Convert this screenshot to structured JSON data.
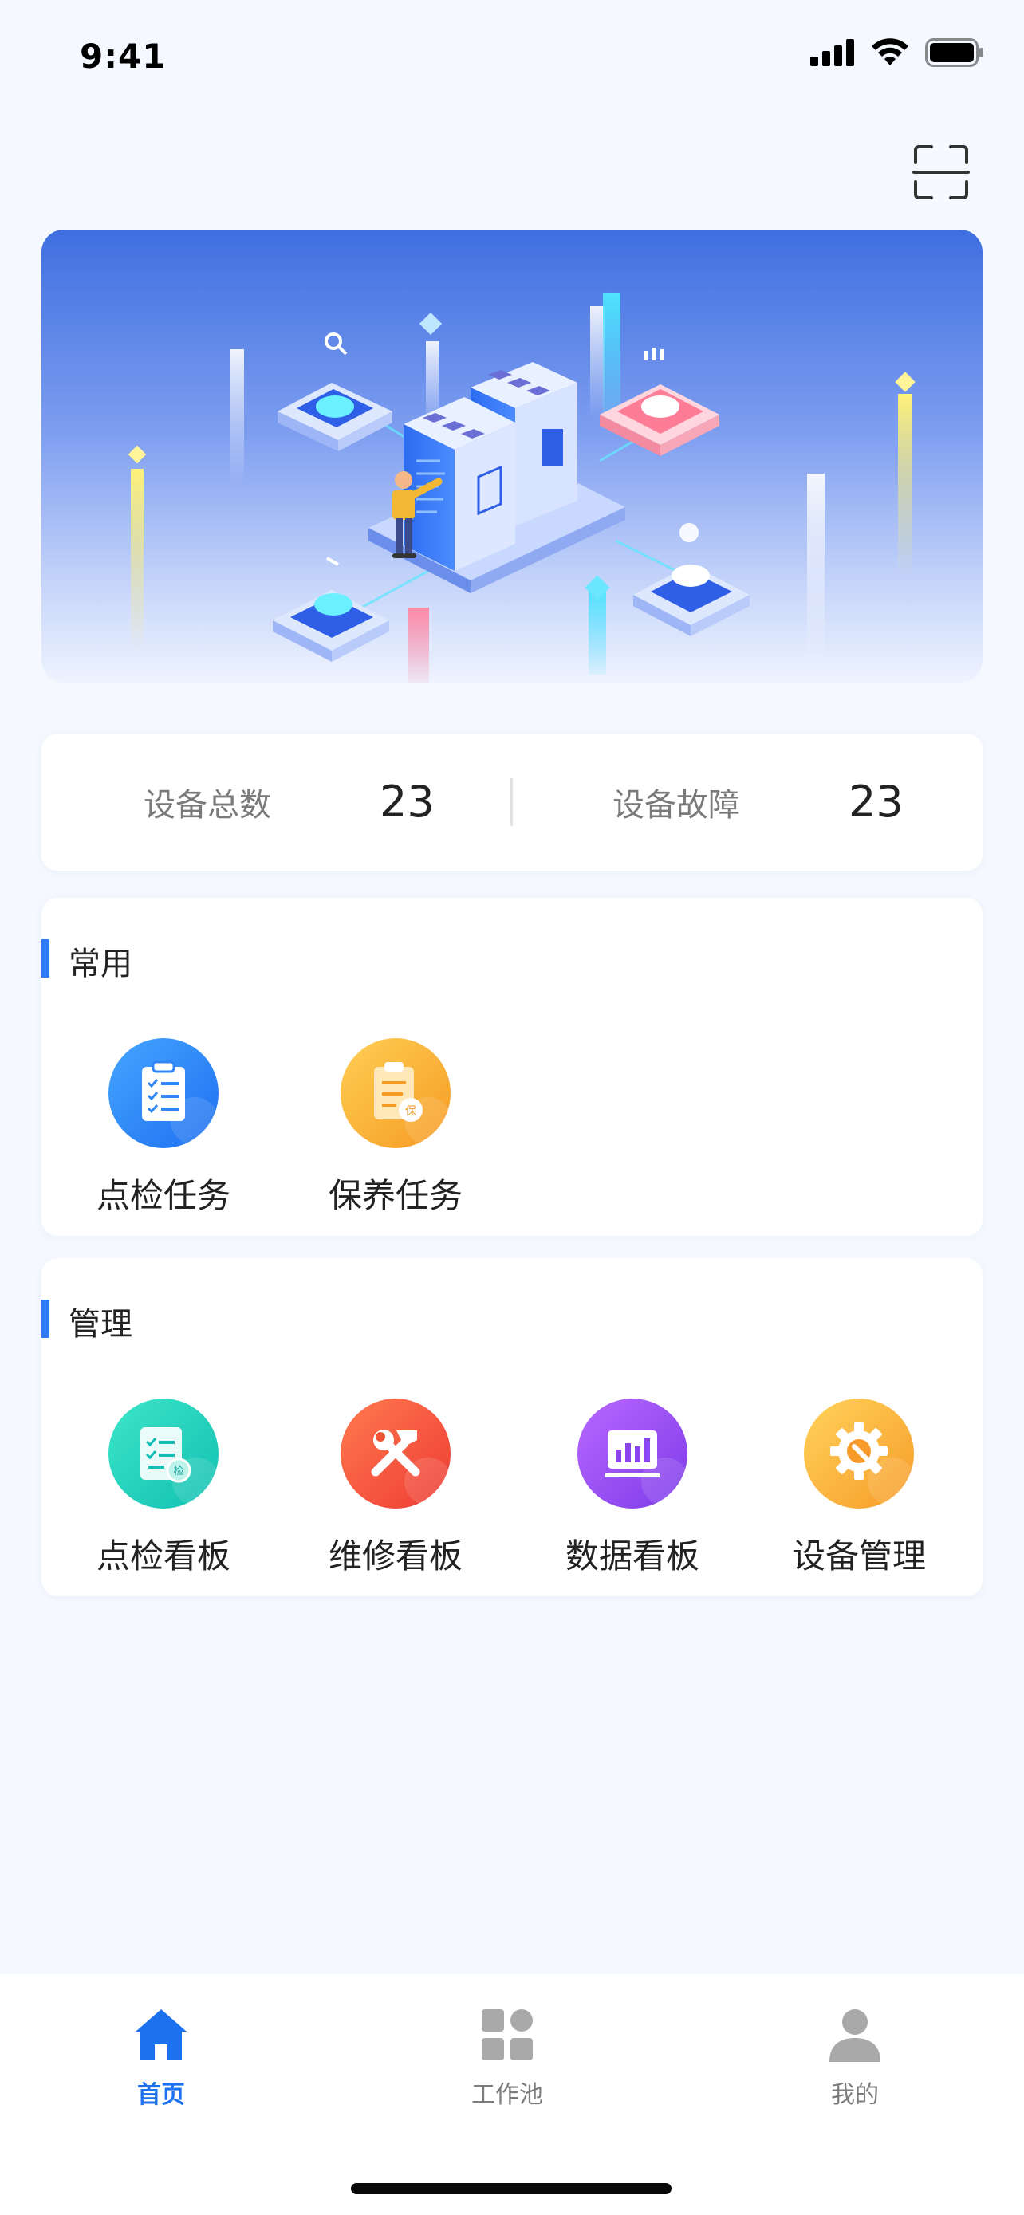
{
  "status_bar": {
    "time": "9:41"
  },
  "stats": [
    {
      "label": "设备总数",
      "value": "23"
    },
    {
      "label": "设备故障",
      "value": "23"
    }
  ],
  "sections": {
    "common": {
      "title": "常用",
      "items": [
        {
          "label": "点检任务",
          "icon": "clipboard-checklist-icon"
        },
        {
          "label": "保养任务",
          "icon": "maintenance-clipboard-icon"
        }
      ]
    },
    "manage": {
      "title": "管理",
      "items": [
        {
          "label": "点检看板",
          "icon": "inspection-board-icon"
        },
        {
          "label": "维修看板",
          "icon": "tools-hammer-wrench-icon"
        },
        {
          "label": "数据看板",
          "icon": "bar-chart-board-icon"
        },
        {
          "label": "设备管理",
          "icon": "gear-wrench-icon"
        }
      ]
    }
  },
  "tabs": [
    {
      "label": "首页",
      "icon": "home-icon",
      "active": true
    },
    {
      "label": "工作池",
      "icon": "grid-icon",
      "active": false
    },
    {
      "label": "我的",
      "icon": "user-icon",
      "active": false
    }
  ],
  "colors": {
    "accent": "#1C71EE",
    "page_bg": "#F5F8FE",
    "banner_top": "#3E6FE0",
    "icon_blue": "#2F86F6",
    "icon_orange": "#FBAE3C",
    "icon_teal": "#22C9BB",
    "icon_red": "#F2503A",
    "icon_purple": "#9B4AF0",
    "icon_yellow": "#FDAE3A"
  }
}
